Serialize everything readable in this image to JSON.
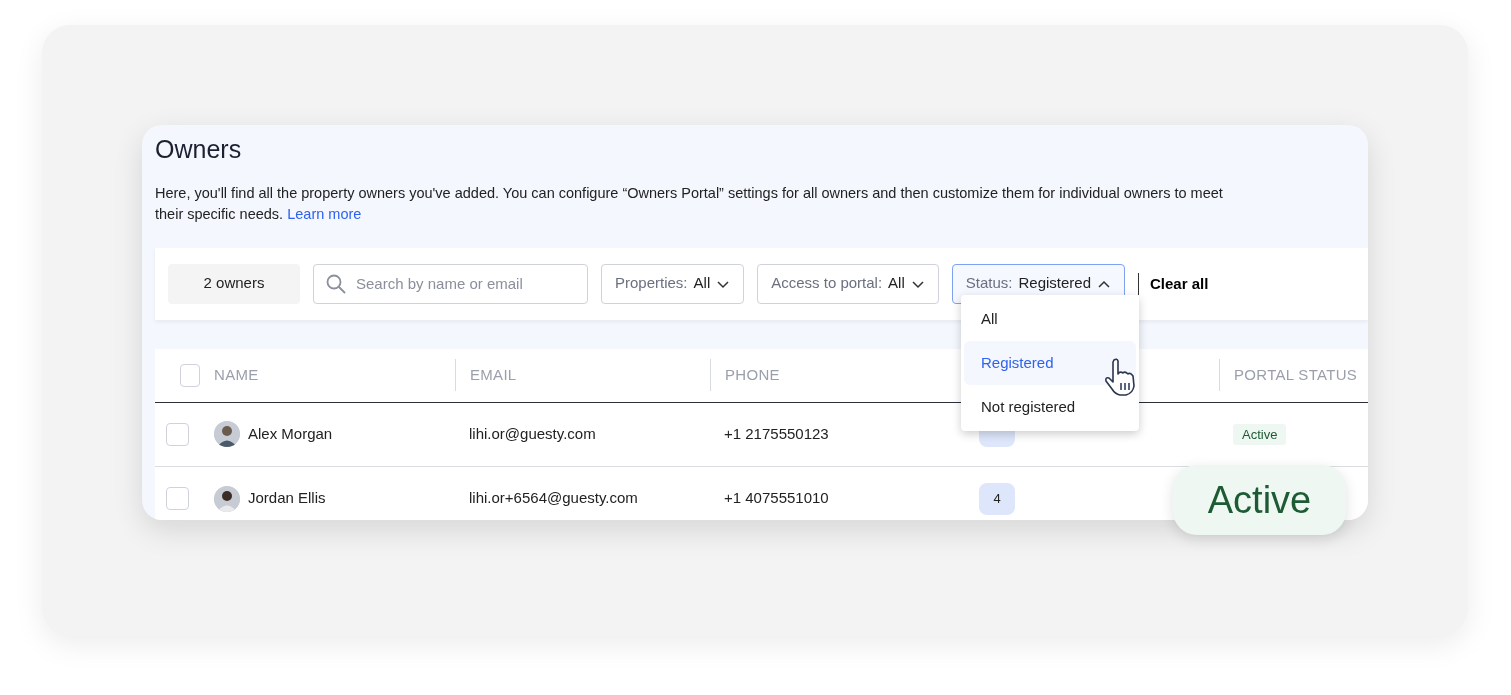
{
  "page": {
    "title": "Owners",
    "description": "Here, you'll find all the property owners you've added. You can configure “Owners Portal” settings for all owners and then customize them for individual owners to meet their specific needs.",
    "link": "Learn more"
  },
  "filters": {
    "count": "2 owners",
    "search": {
      "placeholder": "Search by name or email"
    },
    "dropdowns": [
      {
        "label": "Properties:",
        "value": "All",
        "expanded": false
      },
      {
        "label": "Access to portal:",
        "value": "All",
        "expanded": false
      },
      {
        "label": "Status:",
        "value": "Registered",
        "expanded": true
      }
    ],
    "clear": "Clear all"
  },
  "status_menu": [
    {
      "label": "All",
      "selected": false
    },
    {
      "label": "Registered",
      "selected": true
    },
    {
      "label": "Not registered",
      "selected": false
    }
  ],
  "table": {
    "select_all": {
      "checked": false
    },
    "columns": [
      "NAME",
      "EMAIL",
      "PHONE",
      "PORTAL STATUS"
    ],
    "rows": [
      {
        "checked": false,
        "name": "Alex Morgan",
        "email": "lihi.or@guesty.com",
        "phone": "+1 2175550123",
        "portal_status": "Active"
      },
      {
        "checked": false,
        "name": "Jordan Ellis",
        "email": "lihi.or+6564@guesty.com",
        "phone": "+1 4075551010",
        "properties": "4"
      }
    ]
  },
  "callout": {
    "label": "Active"
  }
}
